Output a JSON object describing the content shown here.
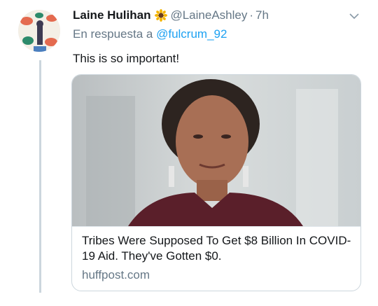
{
  "tweet": {
    "display_name": "Laine Hulihan",
    "name_emoji": "sunflower-icon",
    "handle": "@LaineAshley",
    "separator": "·",
    "time": "7h",
    "reply_prefix": "En respuesta a",
    "reply_to": "@fulcrum_92",
    "text": "This is so important!"
  },
  "card": {
    "title": "Tribes Were Supposed To Get $8 Billion In COVID-19 Aid. They've Gotten $0.",
    "domain": "huffpost.com"
  },
  "colors": {
    "text": "#14171a",
    "muted": "#657786",
    "link": "#1da1f2",
    "border": "#ccd6dd"
  }
}
